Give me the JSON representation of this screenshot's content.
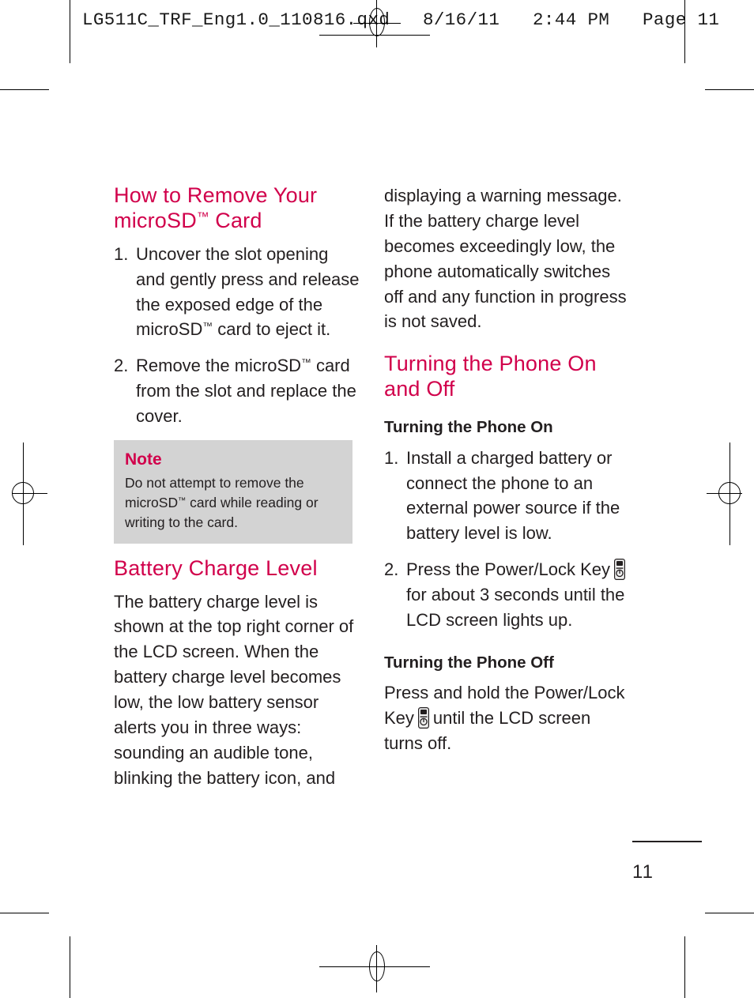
{
  "proof": {
    "header_text": "LG511C_TRF_Eng1.0_110816.qxd   8/16/11   2:44 PM   Page 11"
  },
  "colors": {
    "heading_magenta": "#d1004b",
    "body_text": "#231f20",
    "note_background": "#d3d3d3"
  },
  "left_column": {
    "title": "How to Remove Your microSD™ Card",
    "title_line1": "How to Remove Your",
    "title_line2_pre": "microSD",
    "title_line2_tm": "™",
    "title_line2_post": " Card",
    "steps": [
      {
        "number": "1.",
        "text_pre": "Uncover the slot opening and gently press and release the exposed edge of the microSD",
        "tm": "™",
        "text_post": " card to eject it."
      },
      {
        "number": "2.",
        "text_pre": "Remove the microSD",
        "tm": "™",
        "text_post": " card from the slot and replace the cover."
      }
    ],
    "note": {
      "label": "Note",
      "text_pre": "Do not attempt to remove the microSD",
      "tm": "™",
      "text_post": " card while reading or writing to the card."
    },
    "battery_section": {
      "title": "Battery Charge Level",
      "paragraph": "The battery charge level is shown at the top right corner of the LCD screen. When the battery charge level becomes low, the low battery sensor alerts you in three ways: sounding an audible tone, blinking the battery icon, and"
    }
  },
  "right_column": {
    "continued_paragraph": "displaying a warning message. If the battery charge level becomes exceedingly low, the phone automatically switches off and any function in progress is not saved.",
    "turning_section": {
      "title_line1": "Turning the Phone On",
      "title_line2": "and Off",
      "on_subtitle": "Turning the Phone On",
      "on_steps": [
        {
          "number": "1.",
          "text": "Install a charged battery or connect the phone to an external power source if the battery level is low."
        },
        {
          "number": "2.",
          "text_pre": "Press the Power/Lock Key",
          "icon": "power-lock-key-icon",
          "text_post": "for about 3 seconds until the LCD screen lights up."
        }
      ],
      "off_subtitle": "Turning the Phone Off",
      "off_text_pre": "Press and hold the Power/Lock Key",
      "off_icon": "power-lock-key-icon",
      "off_text_post": "until the LCD screen turns off."
    }
  },
  "footer": {
    "page_number": "11"
  }
}
